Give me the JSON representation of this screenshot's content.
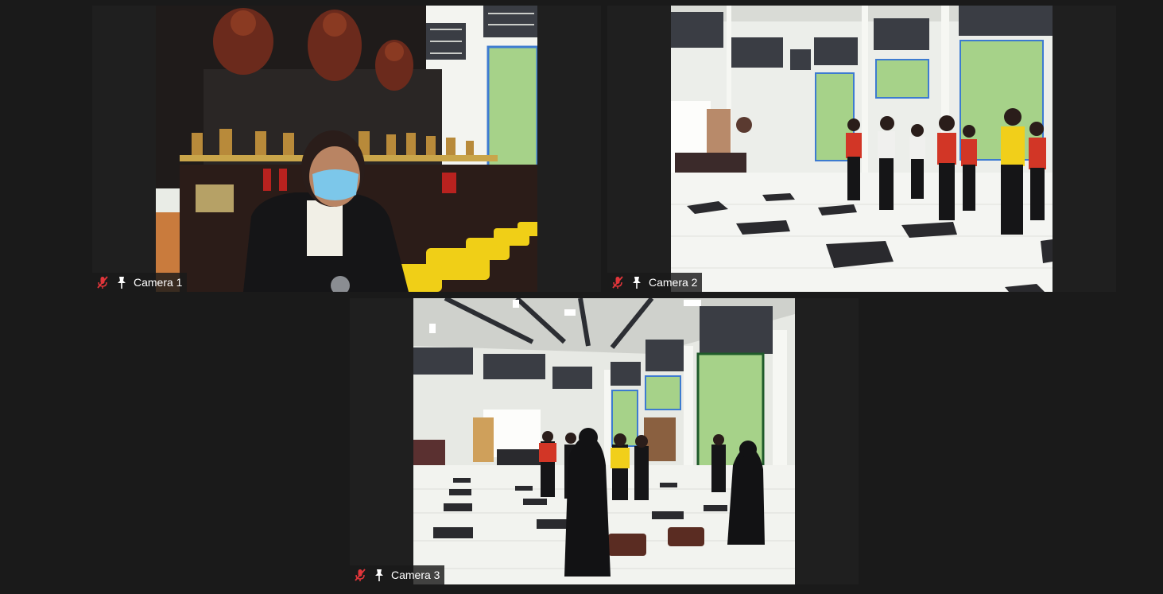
{
  "app": "video-conference-gallery-view",
  "colors": {
    "background": "#1a1a1a",
    "tile_background": "#1f1f1f",
    "muted_icon": "#e0353a",
    "label_text": "#ffffff"
  },
  "participants": [
    {
      "name": "Camera 1",
      "muted": true,
      "pinned": true,
      "icons": [
        "microphone-muted-icon",
        "pin-icon"
      ],
      "scene": "temple-altar-with-masked-presenter"
    },
    {
      "name": "Camera 2",
      "muted": true,
      "pinned": true,
      "icons": [
        "microphone-muted-icon",
        "pin-icon"
      ],
      "scene": "temple-hall-people-in-rows"
    },
    {
      "name": "Camera 3",
      "muted": true,
      "pinned": true,
      "icons": [
        "microphone-muted-icon",
        "pin-icon"
      ],
      "scene": "temple-hall-wide-view-with-mats"
    }
  ]
}
